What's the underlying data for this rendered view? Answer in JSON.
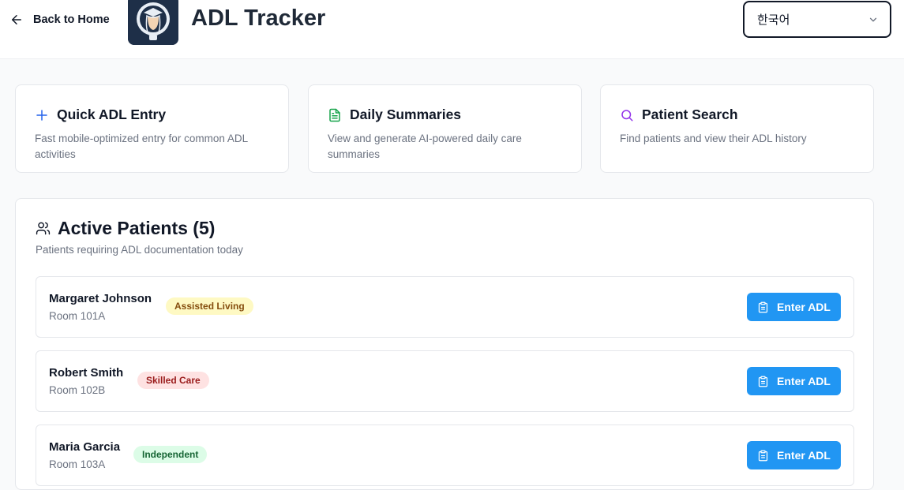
{
  "header": {
    "back_label": "Back to Home",
    "title": "ADL Tracker",
    "language": "한국어"
  },
  "cards": [
    {
      "title": "Quick ADL Entry",
      "description": "Fast mobile-optimized entry for common ADL activities",
      "icon": "plus-icon",
      "icon_color": "#2563eb"
    },
    {
      "title": "Daily Summaries",
      "description": "View and generate AI-powered daily care summaries",
      "icon": "document-icon",
      "icon_color": "#16a34a"
    },
    {
      "title": "Patient Search",
      "description": "Find patients and view their ADL history",
      "icon": "search-icon",
      "icon_color": "#9333ea"
    }
  ],
  "patients_panel": {
    "title": "Active Patients (5)",
    "subtitle": "Patients requiring ADL documentation today",
    "button_label": "Enter ADL",
    "patients": [
      {
        "name": "Margaret Johnson",
        "room": "Room 101A",
        "status": "Assisted Living",
        "status_bg": "#fef9c3",
        "status_fg": "#854d0e"
      },
      {
        "name": "Robert Smith",
        "room": "Room 102B",
        "status": "Skilled Care",
        "status_bg": "#fee2e2",
        "status_fg": "#991b1b"
      },
      {
        "name": "Maria Garcia",
        "room": "Room 103A",
        "status": "Independent",
        "status_bg": "#dcfce7",
        "status_fg": "#166534"
      }
    ]
  },
  "colors": {
    "accent": "#2196f3"
  }
}
